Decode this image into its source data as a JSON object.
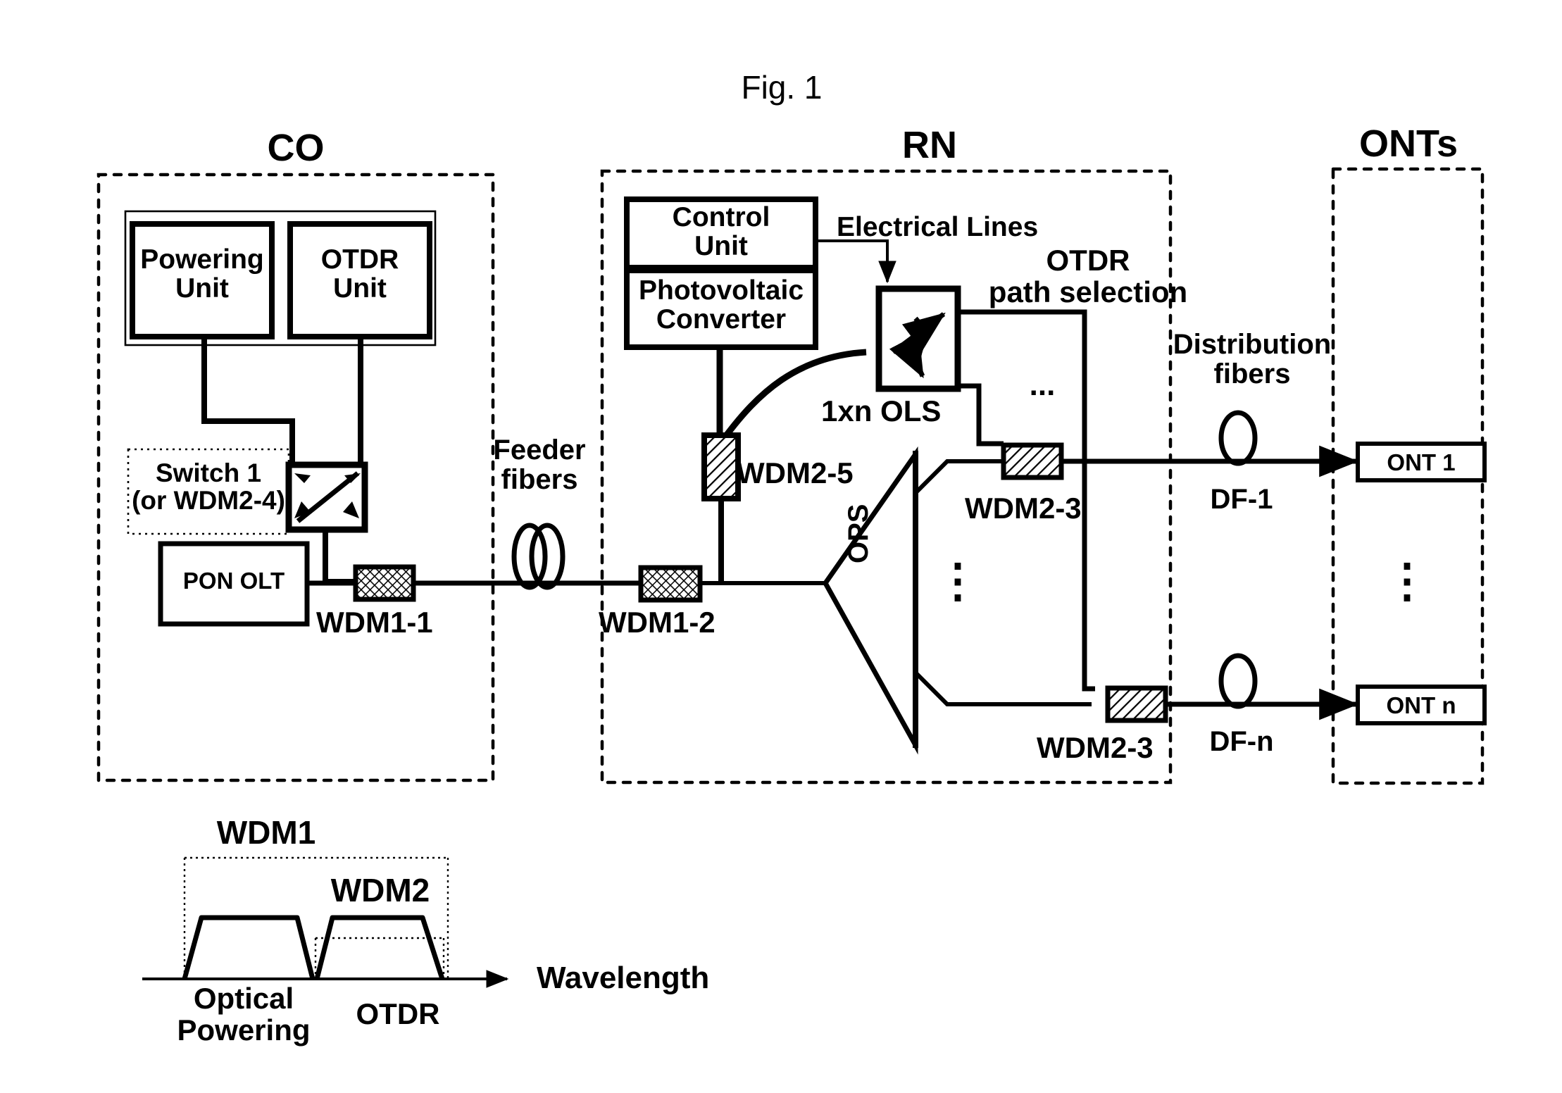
{
  "figure": {
    "title": "Fig. 1"
  },
  "sections": {
    "co": {
      "label": "CO"
    },
    "rn": {
      "label": "RN"
    },
    "onts": {
      "label": "ONTs"
    }
  },
  "co_blocks": {
    "powering_unit": "Powering\nUnit",
    "otdr_unit": "OTDR\nUnit",
    "switch1": "Switch 1\n(or WDM2-4)",
    "pon_olt": "PON OLT",
    "wdm1_1": "WDM1-1"
  },
  "link_labels": {
    "feeder_fibers": "Feeder\nfibers",
    "distribution_fibers": "Distribution\nfibers",
    "df_1": "DF-1",
    "df_n": "DF-n"
  },
  "rn_blocks": {
    "control_unit": "Control\nUnit",
    "photovoltaic_converter": "Photovoltaic\nConverter",
    "electrical_lines": "Electrical Lines",
    "otdr_path_selection": "OTDR\npath selection",
    "ols": "1xn OLS",
    "wdm2_5": "WDM2-5",
    "wdm1_2": "WDM1-2",
    "ops": "OPS",
    "wdm2_3_top": "WDM2-3",
    "wdm2_3_bottom": "WDM2-3",
    "ellipsis_horizontal": "...",
    "ellipsis_vertical": "⋮"
  },
  "ont_blocks": {
    "ont_1": "ONT 1",
    "ont_n": "ONT n",
    "ellipsis_vertical": "⋮"
  },
  "chart_data": {
    "type": "line",
    "title": "",
    "xlabel": "Wavelength",
    "ylabel": "",
    "axis_arrow_label": "Wavelength",
    "band_brackets": [
      {
        "name": "WDM1",
        "label": "WDM1"
      },
      {
        "name": "WDM2",
        "label": "WDM2"
      }
    ],
    "passbands": [
      {
        "label": "Optical\nPowering",
        "name": "optical-powering-band"
      },
      {
        "label": "OTDR",
        "name": "otdr-band"
      }
    ],
    "grid": false,
    "legend": "none"
  },
  "colors": {
    "stroke": "#000000",
    "background": "#ffffff"
  }
}
